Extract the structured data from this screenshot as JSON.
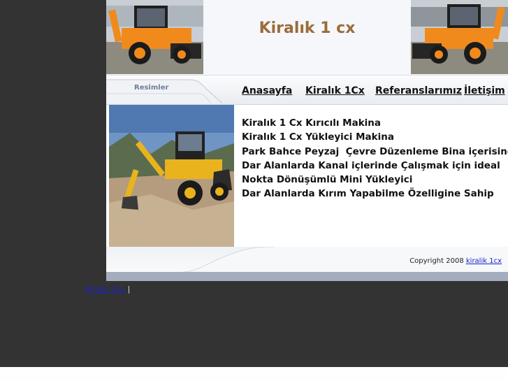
{
  "header": {
    "title": "Kiralık 1 cx"
  },
  "nav": {
    "side_tab_label": "Resimler",
    "links": [
      {
        "label": "Anasayfa"
      },
      {
        "label": "Kiralık 1Cx"
      },
      {
        "label": "Referanslarımız"
      },
      {
        "label": "İletişim"
      }
    ]
  },
  "features": [
    "Kiralık 1 Cx Kırıcılı Makina",
    "Kiralık 1 Cx Yükleyici Makina",
    "Park Bahce Peyzaj  Çevre Düzenleme Bina içerisinde",
    "Dar Alanlarda Kanal içlerinde Çalışmak için ideal",
    "Nokta Dönüşümlü Mini Yükleyici",
    "Dar Alanlarda Kırım Yapabilme Özelligine Sahip"
  ],
  "footer": {
    "copyright_text": "Copyright 2008",
    "copyright_link": "kiralik 1cx"
  },
  "outer_footer": {
    "link": "Kiralık 1cx",
    "separator": "|"
  },
  "colors": {
    "page_background": "#333333",
    "title_color": "#9c6b3a",
    "machine_body": "#f08a1c",
    "link_blue": "#1a22cc"
  },
  "images": {
    "header_left": "orange-backhoe-loader-photo",
    "header_right": "orange-backhoe-loader-photo",
    "content": "yellow-backhoe-on-dirt-photo"
  }
}
